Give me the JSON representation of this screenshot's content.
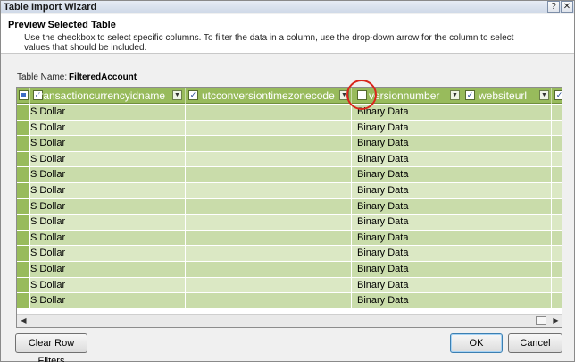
{
  "window": {
    "title": "Table Import Wizard",
    "help_icon": "?",
    "close_icon": "✕"
  },
  "header": {
    "title": "Preview Selected Table",
    "description": "Use the checkbox to select specific columns. To filter the data in a column, use the drop-down arrow  for the column to select values that should be included."
  },
  "table_name": {
    "label": "Table Name:",
    "value": "FilteredAccount"
  },
  "grid": {
    "select_all_checked": true,
    "columns": [
      {
        "label": "transactioncurrencyidname",
        "checked": true
      },
      {
        "label": "utcconversiontimezonecode",
        "checked": true
      },
      {
        "label": "versionnumber",
        "checked": false
      },
      {
        "label": "websiteurl",
        "checked": true
      },
      {
        "label": "",
        "checked": true
      }
    ],
    "rows": [
      [
        "S Dollar",
        "",
        "Binary Data",
        "",
        ""
      ],
      [
        "S Dollar",
        "",
        "Binary Data",
        "",
        ""
      ],
      [
        "S Dollar",
        "",
        "Binary Data",
        "",
        ""
      ],
      [
        "S Dollar",
        "",
        "Binary Data",
        "",
        ""
      ],
      [
        "S Dollar",
        "",
        "Binary Data",
        "",
        ""
      ],
      [
        "S Dollar",
        "",
        "Binary Data",
        "",
        ""
      ],
      [
        "S Dollar",
        "",
        "Binary Data",
        "",
        ""
      ],
      [
        "S Dollar",
        "",
        "Binary Data",
        "",
        ""
      ],
      [
        "S Dollar",
        "",
        "Binary Data",
        "",
        ""
      ],
      [
        "S Dollar",
        "",
        "Binary Data",
        "",
        ""
      ],
      [
        "S Dollar",
        "",
        "Binary Data",
        "",
        ""
      ],
      [
        "S Dollar",
        "",
        "Binary Data",
        "",
        ""
      ],
      [
        "S Dollar",
        "",
        "Binary Data",
        "",
        ""
      ]
    ],
    "highlight_color": "#d9261c",
    "header_color": "#98bb5c"
  },
  "buttons": {
    "clear_row_filters": "Clear Row Filters",
    "ok": "OK",
    "cancel": "Cancel"
  }
}
